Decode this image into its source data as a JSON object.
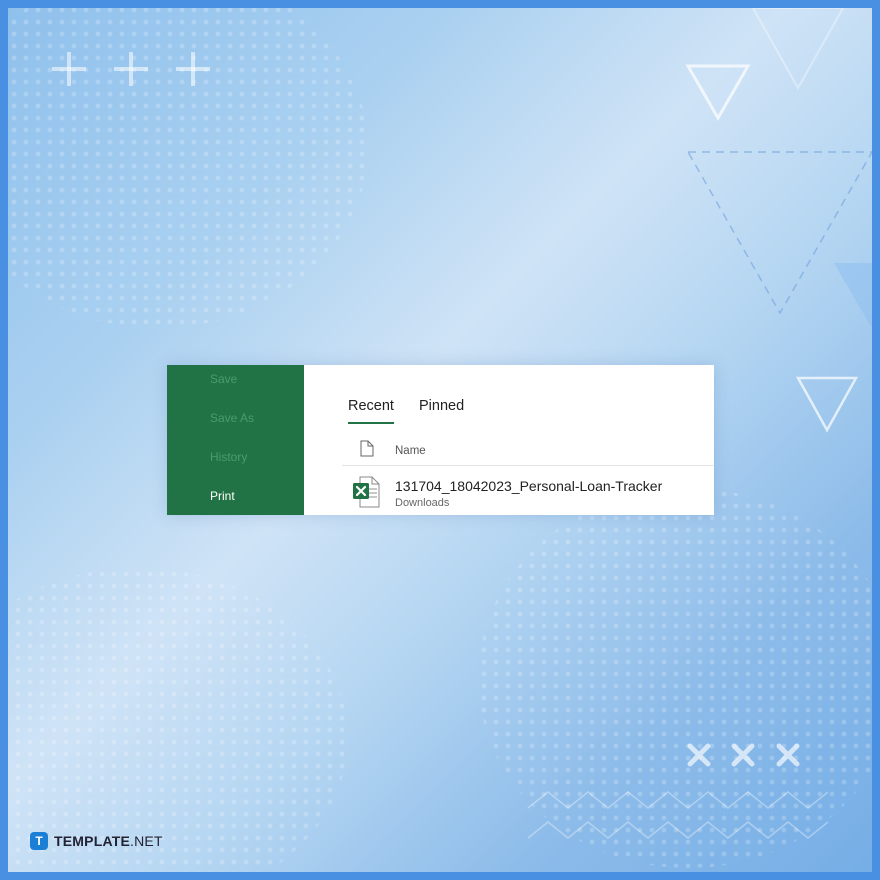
{
  "sidebar": {
    "items": [
      {
        "label": "Save",
        "active": false
      },
      {
        "label": "Save As",
        "active": false
      },
      {
        "label": "History",
        "active": false
      },
      {
        "label": "Print",
        "active": true
      }
    ],
    "color": "#217346"
  },
  "tabs": [
    {
      "label": "Recent",
      "selected": true
    },
    {
      "label": "Pinned",
      "selected": false
    }
  ],
  "file_list": {
    "column_header": "Name",
    "header_icon": "document-icon",
    "files": [
      {
        "name": "131704_18042023_Personal-Loan-Tracker",
        "location": "Downloads",
        "icon": "excel-file-icon"
      }
    ]
  },
  "branding": {
    "logo_mark": "T",
    "name_bold": "TEMPLATE",
    "name_light": ".NET"
  },
  "colors": {
    "frame_border": "#4a90e2",
    "excel_green": "#217346",
    "logo_blue": "#1b7fd6"
  }
}
